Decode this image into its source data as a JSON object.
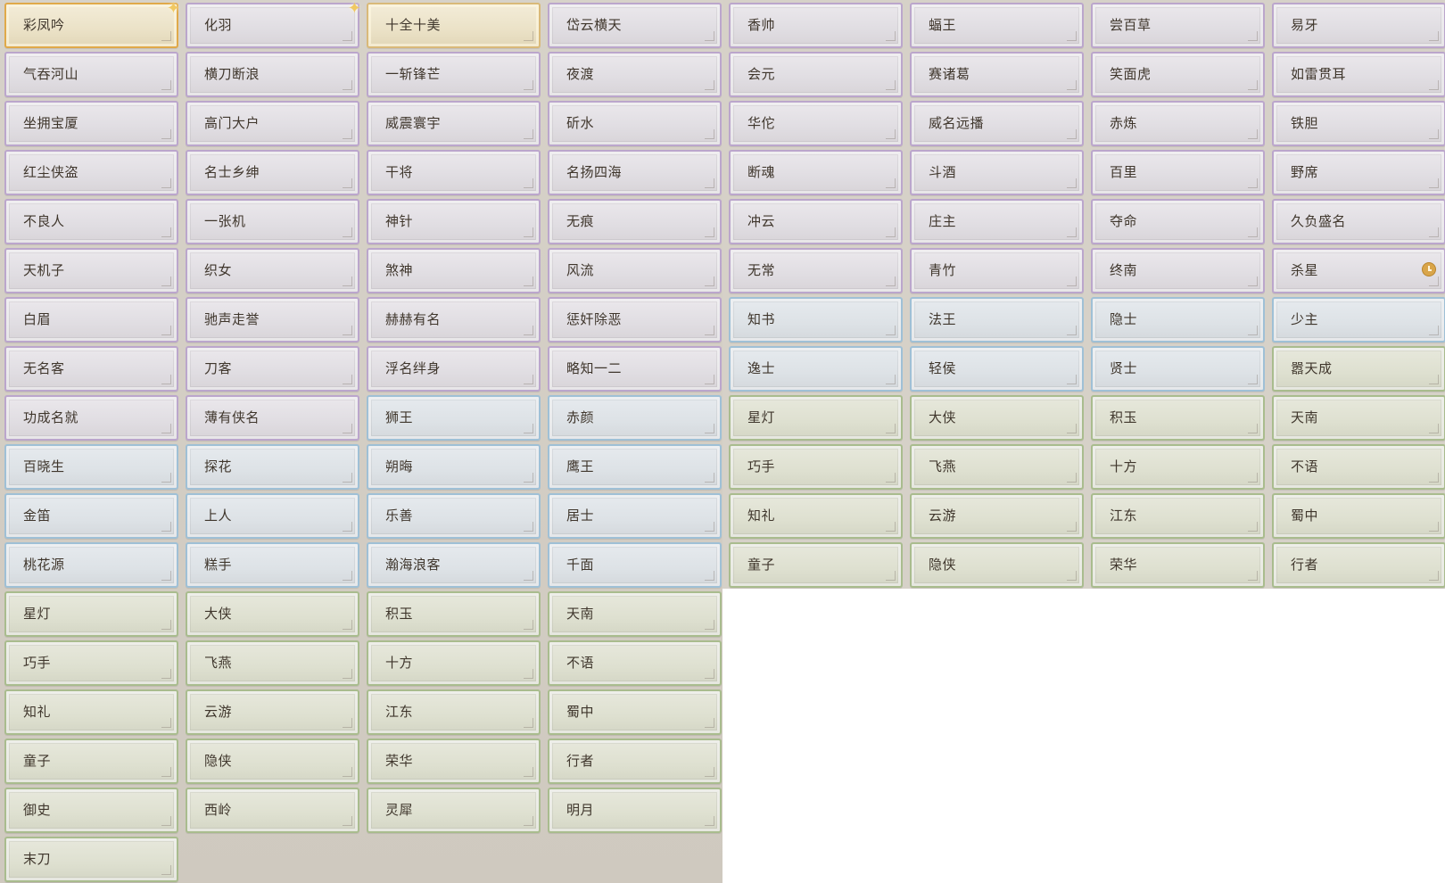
{
  "palette": {
    "gold": "#d9b979",
    "purple": "#bba6cc",
    "blue": "#9fc0d6",
    "green": "#a9bc8e",
    "text": "#3f362c"
  },
  "titles": [
    {
      "label": "彩凤吟",
      "tier": "gold",
      "badge": "sparkle-icon"
    },
    {
      "label": "化羽",
      "tier": "purple",
      "badge": "sparkle-icon"
    },
    {
      "label": "十全十美",
      "tier": "gold"
    },
    {
      "label": "岱云横天",
      "tier": "purple"
    },
    {
      "label": "香帅",
      "tier": "purple"
    },
    {
      "label": "蝠王",
      "tier": "purple"
    },
    {
      "label": "尝百草",
      "tier": "purple"
    },
    {
      "label": "易牙",
      "tier": "purple"
    },
    {
      "label": "气吞河山",
      "tier": "purple"
    },
    {
      "label": "横刀断浪",
      "tier": "purple"
    },
    {
      "label": "一斩锋芒",
      "tier": "purple"
    },
    {
      "label": "夜渡",
      "tier": "purple"
    },
    {
      "label": "会元",
      "tier": "purple"
    },
    {
      "label": "赛诸葛",
      "tier": "purple"
    },
    {
      "label": "笑面虎",
      "tier": "purple"
    },
    {
      "label": "如雷贯耳",
      "tier": "purple"
    },
    {
      "label": "坐拥宝厦",
      "tier": "purple"
    },
    {
      "label": "高门大户",
      "tier": "purple"
    },
    {
      "label": "威震寰宇",
      "tier": "purple"
    },
    {
      "label": "斫水",
      "tier": "purple"
    },
    {
      "label": "华佗",
      "tier": "purple"
    },
    {
      "label": "威名远播",
      "tier": "purple"
    },
    {
      "label": "赤炼",
      "tier": "purple"
    },
    {
      "label": "铁胆",
      "tier": "purple"
    },
    {
      "label": "红尘侠盗",
      "tier": "purple"
    },
    {
      "label": "名士乡绅",
      "tier": "purple"
    },
    {
      "label": "干将",
      "tier": "purple"
    },
    {
      "label": "名扬四海",
      "tier": "purple"
    },
    {
      "label": "断魂",
      "tier": "purple"
    },
    {
      "label": "斗酒",
      "tier": "purple"
    },
    {
      "label": "百里",
      "tier": "purple"
    },
    {
      "label": "野席",
      "tier": "purple"
    },
    {
      "label": "不良人",
      "tier": "purple"
    },
    {
      "label": "一张机",
      "tier": "purple"
    },
    {
      "label": "神针",
      "tier": "purple"
    },
    {
      "label": "无痕",
      "tier": "purple"
    },
    {
      "label": "冲云",
      "tier": "purple"
    },
    {
      "label": "庄主",
      "tier": "purple"
    },
    {
      "label": "夺命",
      "tier": "purple"
    },
    {
      "label": "久负盛名",
      "tier": "purple"
    },
    {
      "label": "天机子",
      "tier": "purple"
    },
    {
      "label": "织女",
      "tier": "purple"
    },
    {
      "label": "煞神",
      "tier": "purple"
    },
    {
      "label": "风流",
      "tier": "purple"
    },
    {
      "label": "无常",
      "tier": "purple"
    },
    {
      "label": "青竹",
      "tier": "purple"
    },
    {
      "label": "终南",
      "tier": "purple"
    },
    {
      "label": "杀星",
      "tier": "purple",
      "badge": "clock-icon"
    },
    {
      "label": "白眉",
      "tier": "purple"
    },
    {
      "label": "驰声走誉",
      "tier": "purple"
    },
    {
      "label": "赫赫有名",
      "tier": "purple"
    },
    {
      "label": "惩奸除恶",
      "tier": "purple"
    },
    {
      "label": "知书",
      "tier": "blue"
    },
    {
      "label": "法王",
      "tier": "blue"
    },
    {
      "label": "隐士",
      "tier": "blue"
    },
    {
      "label": "少主",
      "tier": "blue"
    },
    {
      "label": "无名客",
      "tier": "purple"
    },
    {
      "label": "刀客",
      "tier": "purple"
    },
    {
      "label": "浮名绊身",
      "tier": "purple"
    },
    {
      "label": "略知一二",
      "tier": "purple"
    },
    {
      "label": "逸士",
      "tier": "blue"
    },
    {
      "label": "轻侯",
      "tier": "blue"
    },
    {
      "label": "贤士",
      "tier": "blue"
    },
    {
      "label": "嚣天成",
      "tier": "green"
    },
    {
      "label": "功成名就",
      "tier": "purple"
    },
    {
      "label": "薄有侠名",
      "tier": "purple"
    },
    {
      "label": "狮王",
      "tier": "blue"
    },
    {
      "label": "赤颜",
      "tier": "blue"
    },
    {
      "label": "星灯",
      "tier": "green"
    },
    {
      "label": "大侠",
      "tier": "green"
    },
    {
      "label": "积玉",
      "tier": "green"
    },
    {
      "label": "天南",
      "tier": "green"
    },
    {
      "label": "百晓生",
      "tier": "blue"
    },
    {
      "label": "探花",
      "tier": "blue"
    },
    {
      "label": "朔晦",
      "tier": "blue"
    },
    {
      "label": "鹰王",
      "tier": "blue"
    },
    {
      "label": "巧手",
      "tier": "green"
    },
    {
      "label": "飞燕",
      "tier": "green"
    },
    {
      "label": "十方",
      "tier": "green"
    },
    {
      "label": "不语",
      "tier": "green"
    },
    {
      "label": "金笛",
      "tier": "blue"
    },
    {
      "label": "上人",
      "tier": "blue"
    },
    {
      "label": "乐善",
      "tier": "blue"
    },
    {
      "label": "居士",
      "tier": "blue"
    },
    {
      "label": "知礼",
      "tier": "green"
    },
    {
      "label": "云游",
      "tier": "green"
    },
    {
      "label": "江东",
      "tier": "green"
    },
    {
      "label": "蜀中",
      "tier": "green"
    },
    {
      "label": "桃花源",
      "tier": "blue"
    },
    {
      "label": "糕手",
      "tier": "blue"
    },
    {
      "label": "瀚海浪客",
      "tier": "blue"
    },
    {
      "label": "千面",
      "tier": "blue"
    },
    {
      "label": "童子",
      "tier": "green"
    },
    {
      "label": "隐侠",
      "tier": "green"
    },
    {
      "label": "荣华",
      "tier": "green"
    },
    {
      "label": "行者",
      "tier": "green"
    },
    {
      "label": "星灯",
      "tier": "green"
    },
    {
      "label": "大侠",
      "tier": "green"
    },
    {
      "label": "积玉",
      "tier": "green"
    },
    {
      "label": "天南",
      "tier": "green"
    },
    {
      "label": "巧手",
      "tier": "green"
    },
    {
      "label": "飞燕",
      "tier": "green"
    },
    {
      "label": "十方",
      "tier": "green"
    },
    {
      "label": "不语",
      "tier": "green"
    },
    {
      "label": "知礼",
      "tier": "green"
    },
    {
      "label": "云游",
      "tier": "green"
    },
    {
      "label": "江东",
      "tier": "green"
    },
    {
      "label": "蜀中",
      "tier": "green"
    },
    {
      "label": "童子",
      "tier": "green"
    },
    {
      "label": "隐侠",
      "tier": "green"
    },
    {
      "label": "荣华",
      "tier": "green"
    },
    {
      "label": "行者",
      "tier": "green"
    },
    {
      "label": "御史",
      "tier": "green"
    },
    {
      "label": "西岭",
      "tier": "green"
    },
    {
      "label": "灵犀",
      "tier": "green"
    },
    {
      "label": "明月",
      "tier": "green"
    },
    {
      "label": "末刀",
      "tier": "green"
    }
  ]
}
